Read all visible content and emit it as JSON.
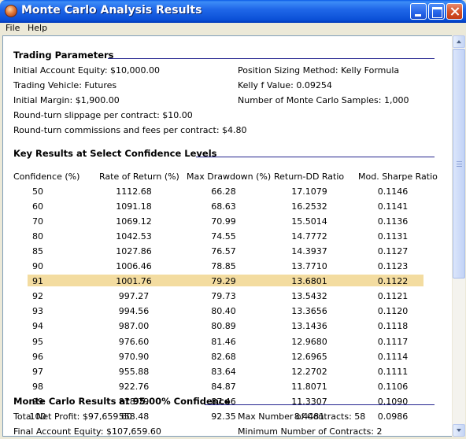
{
  "window": {
    "title": "Monte Carlo Analysis Results"
  },
  "menu": [
    "File",
    "Help"
  ],
  "trading_parameters": {
    "heading": "Trading Parameters",
    "left": [
      "Initial Account Equity: $10,000.00",
      "Trading Vehicle:  Futures",
      "Initial Margin: $1,900.00",
      "Round-turn slippage per contract: $10.00",
      "Round-turn commissions and fees per contract: $4.80"
    ],
    "right": [
      "Position Sizing Method: Kelly Formula",
      "Kelly f Value: 0.09254",
      "Number of Monte Carlo Samples: 1,000"
    ]
  },
  "key_results": {
    "heading": "Key Results at Select Confidence Levels",
    "columns": [
      "Confidence (%)",
      "Rate of Return (%)",
      "Max Drawdown (%)",
      "Return-DD Ratio",
      "Mod. Sharpe Ratio"
    ],
    "highlighted_row_index": 6,
    "rows": [
      [
        "50",
        "1112.68",
        "66.28",
        "17.1079",
        "0.1146"
      ],
      [
        "60",
        "1091.18",
        "68.63",
        "16.2532",
        "0.1141"
      ],
      [
        "70",
        "1069.12",
        "70.99",
        "15.5014",
        "0.1136"
      ],
      [
        "80",
        "1042.53",
        "74.55",
        "14.7772",
        "0.1131"
      ],
      [
        "85",
        "1027.86",
        "76.57",
        "14.3937",
        "0.1127"
      ],
      [
        "90",
        "1006.46",
        "78.85",
        "13.7710",
        "0.1123"
      ],
      [
        "91",
        "1001.76",
        "79.29",
        "13.6801",
        "0.1122"
      ],
      [
        "92",
        "997.27",
        "79.73",
        "13.5432",
        "0.1121"
      ],
      [
        "93",
        "994.56",
        "80.40",
        "13.3656",
        "0.1120"
      ],
      [
        "94",
        "987.00",
        "80.89",
        "13.1436",
        "0.1118"
      ],
      [
        "95",
        "976.60",
        "81.46",
        "12.9680",
        "0.1117"
      ],
      [
        "96",
        "970.90",
        "82.68",
        "12.6965",
        "0.1114"
      ],
      [
        "97",
        "955.88",
        "83.64",
        "12.2702",
        "0.1111"
      ],
      [
        "98",
        "922.76",
        "84.87",
        "11.8071",
        "0.1106"
      ],
      [
        "99",
        "878.79",
        "87.46",
        "11.3307",
        "0.1090"
      ],
      [
        "100",
        "558.48",
        "92.35",
        "8.4481",
        "0.0986"
      ]
    ]
  },
  "confidence_results": {
    "heading": "Monte Carlo Results at 95.00% Confidence",
    "left": [
      "Total Net Profit: $97,659.60",
      "Final Account Equity: $107,659.60"
    ],
    "right": [
      "Max Number of Contracts: 58",
      "Minimum Number of Contracts: 2"
    ]
  },
  "colors": {
    "highlight": "#F3DCA0",
    "title_bar": "#0A4FD6",
    "section_rule": "#23238E"
  },
  "icons": [
    "app-icon",
    "minimize-icon",
    "maximize-icon",
    "close-icon",
    "scroll-up-icon",
    "scroll-down-icon"
  ]
}
